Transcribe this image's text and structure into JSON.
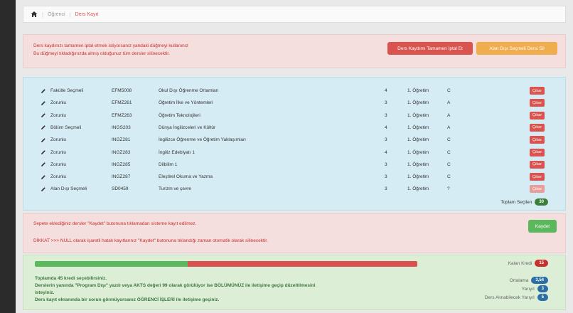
{
  "breadcrumb": {
    "items": [
      "Öğrenci",
      "Ders Kayıt"
    ]
  },
  "warning_top": {
    "line1": "Ders kaydınızı tamamen iptal etmek istiyorsanız yandaki düğmeyi kullanınız",
    "line2": "Bu düğmeyi tıkladığınızda almış olduğunuz tüm dersler silinecektir.",
    "cancel_all_label": "Ders Kaydımı Tamamen İptal Et",
    "delete_elective_label": "Alan Dışı Seçmeli Dersi Sil"
  },
  "courses": [
    {
      "type": "Fakülte Seçmeli",
      "code": "EFM5008",
      "name": "Okul Dışı Öğrenme Ortamları",
      "credit": "4",
      "lang": "1. Öğretim",
      "grade": "C",
      "action": "Çıkar"
    },
    {
      "type": "Zorunlu",
      "code": "EFMZ261",
      "name": "Öğretim İlke ve Yöntemleri",
      "credit": "3",
      "lang": "1. Öğretim",
      "grade": "A",
      "action": "Çıkar"
    },
    {
      "type": "Zorunlu",
      "code": "EFMZ263",
      "name": "Öğretim Teknolojileri",
      "credit": "3",
      "lang": "1. Öğretim",
      "grade": "A",
      "action": "Çıkar"
    },
    {
      "type": "Bölüm Seçmeli",
      "code": "INGS203",
      "name": "Dünya İngilizceleri ve Kültür",
      "credit": "4",
      "lang": "1. Öğretim",
      "grade": "A",
      "action": "Çıkar"
    },
    {
      "type": "Zorunlu",
      "code": "INGZ281",
      "name": "İngilizce Öğrenme ve Öğretim Yaklaşımları",
      "credit": "3",
      "lang": "1. Öğretim",
      "grade": "C",
      "action": "Çıkar"
    },
    {
      "type": "Zorunlu",
      "code": "INGZ283",
      "name": "İngiliz Edebiyatı 1",
      "credit": "4",
      "lang": "1. Öğretim",
      "grade": "C",
      "action": "Çıkar"
    },
    {
      "type": "Zorunlu",
      "code": "INGZ285",
      "name": "Dilbilim 1",
      "credit": "3",
      "lang": "1. Öğretim",
      "grade": "C",
      "action": "Çıkar"
    },
    {
      "type": "Zorunlu",
      "code": "INGZ287",
      "name": "Eleştirel Okuma ve Yazma",
      "credit": "3",
      "lang": "1. Öğretim",
      "grade": "C",
      "action": "Çıkar"
    },
    {
      "type": "Alan Dışı Seçmeli",
      "code": "SD0459",
      "name": "Turizm ve çevre",
      "credit": "3",
      "lang": "1. Öğretim",
      "grade": "?",
      "action": "Çıkar"
    }
  ],
  "total": {
    "label": "Toplam Seçilen",
    "value": "30"
  },
  "warning_mid": {
    "line1": "Sepete eklediğiniz dersler \"Kaydet\" butonuna tıklamadan sisteme kayıt edilmez.",
    "line2": "DİKKAT >>> NULL olarak işaretli hatalı kayıtlarınız \"Kaydet\" butonuna tıklandığı zaman otomatik olarak silinecektir.",
    "save_label": "Kaydet"
  },
  "progress": {
    "fraction_done": 0.4
  },
  "remaining": {
    "label": "Kalan Kredi",
    "value": "15"
  },
  "info": {
    "line1": "Toplamda 45 kredi seçebilirsiniz.",
    "line2": "Derslerin yanında \"Program Dışı\" yazılı veya AKTS değeri 99 olarak görülüyor ise BÖLÜMÜNÜZ ile iletişime geçip düzeltilmesini",
    "line3": "isteyiniz.",
    "line4": "Ders kayıt ekranında bir sorun görmüyorsanız ÖĞRENCİ İŞLERİ ile iletişime geçiniz."
  },
  "stats": {
    "gpa_label": "Ortalama",
    "gpa_value": "3,54",
    "semester_label": "Yarıyıl",
    "semester_value": "3",
    "next_label": "Ders Alınabilecek Yarıyıl",
    "next_value": "5"
  },
  "colors": {
    "accent_red": "#d9534f",
    "accent_green": "#5cb85c",
    "accent_orange": "#f0ad4e",
    "info_blue": "#d6ecf5"
  },
  "icons": {
    "home": "home-icon",
    "edit": "pencil-icon"
  }
}
